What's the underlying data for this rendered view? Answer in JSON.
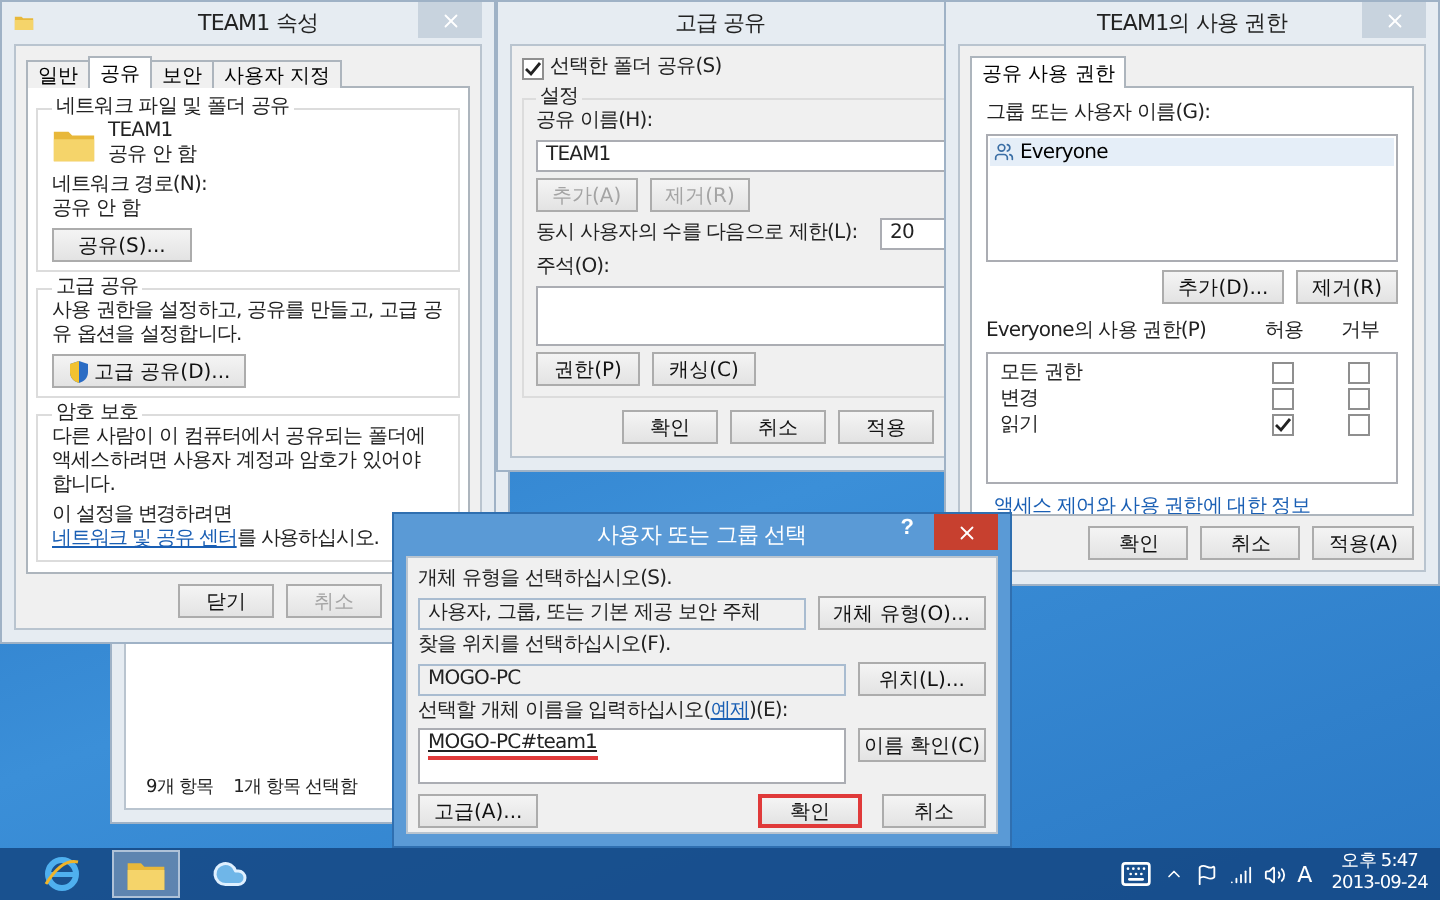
{
  "explorer_window": {
    "status_items": [
      "9개 항목",
      "1개 항목 선택함"
    ]
  },
  "properties_window": {
    "title": "TEAM1 속성",
    "tabs": [
      {
        "label": "일반",
        "selected": false
      },
      {
        "label": "공유",
        "selected": true
      },
      {
        "label": "보안",
        "selected": false
      },
      {
        "label": "사용자 지정",
        "selected": false
      }
    ],
    "network_sharing": {
      "heading": "네트워크 파일 및 폴더 공유",
      "folder_name": "TEAM1",
      "folder_status": "공유 안 함",
      "path_label": "네트워크 경로(N):",
      "path_value": "공유 안 함",
      "button": "공유(S)..."
    },
    "advanced_sharing": {
      "heading": "고급 공유",
      "description": "사용 권한을 설정하고, 공유를 만들고, 고급 공유 옵션을 설정합니다.",
      "button": "고급 공유(D)..."
    },
    "password_protection": {
      "heading": "암호 보호",
      "description": "다른 사람이 이 컴퓨터에서 공유되는 폴더에 액세스하려면 사용자 계정과 암호가 있어야 합니다.",
      "change_before": "이 설정을 변경하려면 ",
      "link": "네트워크 및 공유 센터",
      "change_after": "를 사용하십시오."
    },
    "buttons": [
      {
        "label": "닫기",
        "disabled": false
      },
      {
        "label": "취소",
        "disabled": true
      }
    ]
  },
  "advanced_sharing_window": {
    "title": "고급 공유",
    "share_checkbox": {
      "label": "선택한 폴더 공유(S)",
      "checked": true
    },
    "settings_heading": "설정",
    "share_name_label": "공유 이름(H):",
    "share_name": "TEAM1",
    "name_buttons": [
      {
        "label": "추가(A)",
        "disabled": true
      },
      {
        "label": "제거(R)",
        "disabled": true
      }
    ],
    "limit_label": "동시 사용자의 수를 다음으로 제한(L):",
    "limit_value": "20",
    "comment_label": "주석(O):",
    "option_buttons": [
      "권한(P)",
      "캐싱(C)"
    ],
    "buttons": [
      "확인",
      "취소",
      "적용"
    ]
  },
  "permissions_window": {
    "title": "TEAM1의 사용 권한",
    "tabs": [
      {
        "label": "공유 사용 권한",
        "selected": true
      }
    ],
    "users_label": "그룹 또는 사용자 이름(G):",
    "users": [
      {
        "name": "Everyone",
        "selected": true
      }
    ],
    "user_buttons": [
      "추가(D)...",
      "제거(R)"
    ],
    "permissions_label": "Everyone의 사용 권한(P)",
    "columns": [
      "허용",
      "거부"
    ],
    "permissions": [
      {
        "name": "모든 권한",
        "allow": false,
        "deny": false
      },
      {
        "name": "변경",
        "allow": false,
        "deny": false
      },
      {
        "name": "읽기",
        "allow": true,
        "deny": false
      }
    ],
    "link": "액세스 제어와 사용 권한에 대한 정보",
    "buttons": [
      "확인",
      "취소",
      "적용(A)"
    ]
  },
  "select_dialog": {
    "title": "사용자 또는 그룹 선택",
    "help": "?",
    "type_label": "개체 유형을 선택하십시오(S).",
    "type_value": "사용자, 그룹, 또는 기본 제공 보안 주체",
    "type_button": "개체 유형(O)...",
    "location_label": "찾을 위치를 선택하십시오(F).",
    "location_value": "MOGO-PC",
    "location_button": "위치(L)...",
    "name_label_before": "선택할 개체 이름을 입력하십시오(",
    "name_label_link": "예제",
    "name_label_after": ")(E):",
    "name_value": "MOGO-PC#team1",
    "name_underlined": true,
    "check_button": "이름 확인(C)",
    "advanced_button": "고급(A)...",
    "ok_button": {
      "label": "확인",
      "marked": true
    },
    "cancel_button": "취소"
  },
  "taskbar": {
    "ime": "A",
    "time": "오후 5:47",
    "date": "2013-09-24"
  }
}
